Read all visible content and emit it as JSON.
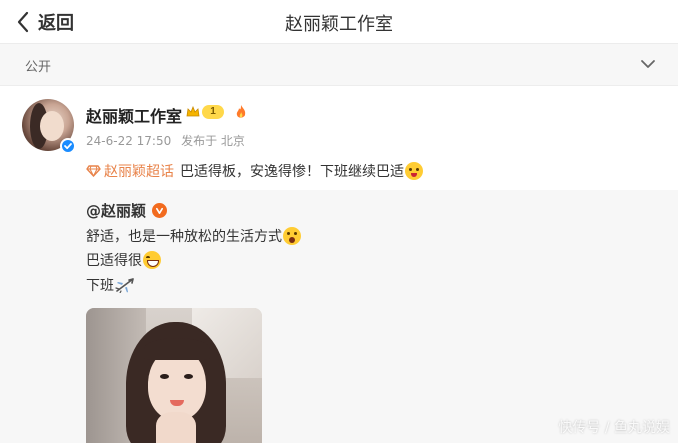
{
  "colors": {
    "topic_orange": "#e8834a",
    "verified_blue": "#1a8cff",
    "vip_gold": "#ffd84a",
    "orange_v": "#f26b1f"
  },
  "nav": {
    "back_icon": "chevron-left-icon",
    "back_label": "返回",
    "title": "赵丽颖工作室"
  },
  "visibility": {
    "label": "公开",
    "icon": "chevron-down-icon"
  },
  "post": {
    "author": "赵丽颖工作室",
    "level": "1",
    "badge_icons": [
      "crown-icon",
      "flame-icon"
    ],
    "timestamp": "24-6-22 17:50",
    "location": "发布于 北京",
    "topic_icon": "supertopic-icon",
    "topic": "赵丽颖超话",
    "text": "巴适得板，安逸得惨！下班继续巴适",
    "text_emoji": "party-emoji"
  },
  "repost": {
    "author": "@赵丽颖",
    "lines": [
      {
        "text": "舒适，也是一种放松的生活方式",
        "emoji": "wow-emoji"
      },
      {
        "text": "巴适得很",
        "emoji": "grin-emoji"
      },
      {
        "text": "下班",
        "emoji": "airplane-emoji"
      }
    ],
    "image": "selfie-photo"
  },
  "watermark": "快传号 / 鱼丸说娱"
}
